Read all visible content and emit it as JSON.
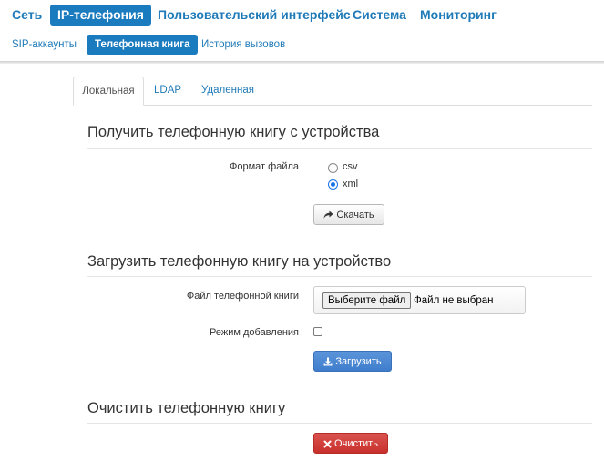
{
  "top_nav": {
    "items": [
      {
        "label": "Сеть",
        "active": false
      },
      {
        "label": "IP-телефония",
        "active": true
      },
      {
        "label": "Пользовательский интерфейс",
        "active": false
      },
      {
        "label": "Система",
        "active": false
      },
      {
        "label": "Мониторинг",
        "active": false
      }
    ]
  },
  "sub_nav": {
    "items": [
      {
        "label": "SIP-аккаунты",
        "active": false
      },
      {
        "label": "Телефонная книга",
        "active": true
      },
      {
        "label": "История вызовов",
        "active": false
      }
    ]
  },
  "tabs": [
    {
      "label": "Локальная",
      "active": true
    },
    {
      "label": "LDAP",
      "active": false
    },
    {
      "label": "Удаленная",
      "active": false
    }
  ],
  "download_section": {
    "title": "Получить телефонную книгу с устройства",
    "format_label": "Формат файла",
    "options": [
      {
        "label": "csv",
        "checked": false
      },
      {
        "label": "xml",
        "checked": true
      }
    ],
    "button_label": "Скачать",
    "button_icon": "share-arrow-icon"
  },
  "upload_section": {
    "title": "Загрузить телефонную книгу на устройство",
    "file_label": "Файл телефонной книги",
    "choose_file_label": "Выберите файл",
    "file_status": "Файл не выбран",
    "append_mode_label": "Режим добавления",
    "append_mode_checked": false,
    "button_label": "Загрузить",
    "button_icon": "download-icon"
  },
  "clear_section": {
    "title": "Очистить телефонную книгу",
    "button_label": "Очистить",
    "button_icon": "close-icon"
  },
  "colors": {
    "accent": "#1b7bbf",
    "primary_button": "#428bca",
    "danger_button": "#d9534f"
  }
}
